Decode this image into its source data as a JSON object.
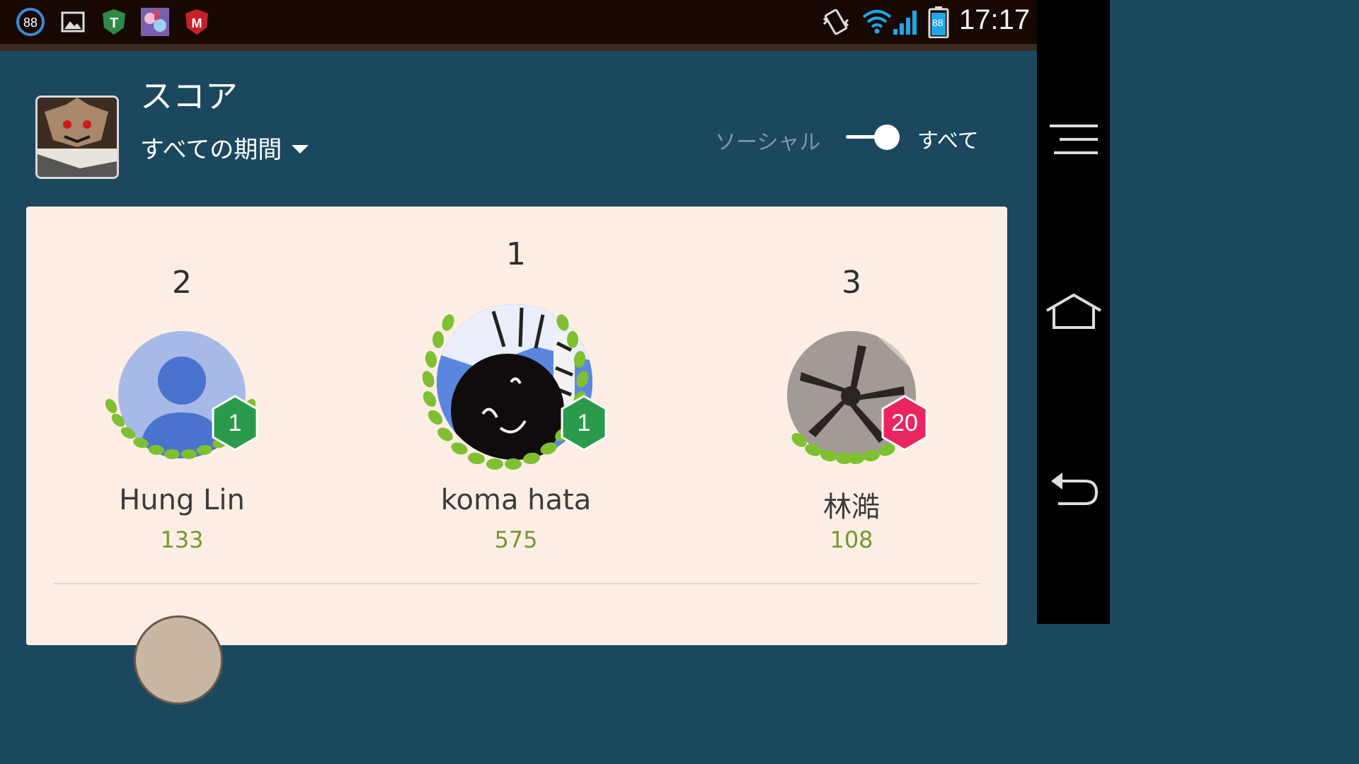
{
  "status_bar": {
    "notification_icons": [
      "battery-88-icon",
      "gallery-icon",
      "trend-micro-icon",
      "game-app-icon",
      "mcafee-icon"
    ],
    "system_icons": [
      "vibrate-icon",
      "wifi-icon",
      "cell-signal-icon",
      "battery-icon"
    ],
    "battery_badge": "88",
    "clock": "17:17"
  },
  "header": {
    "title": "スコア",
    "period_label": "すべての期間",
    "filter": {
      "left_label": "ソーシャル",
      "right_label": "すべて",
      "selected": "すべて"
    }
  },
  "leaderboard": {
    "players": [
      {
        "rank": "2",
        "name": "Hung Lin",
        "score": "133",
        "level": "1",
        "level_color": "#2a9b4a"
      },
      {
        "rank": "1",
        "name": "koma hata",
        "score": "575",
        "level": "1",
        "level_color": "#2a9b4a"
      },
      {
        "rank": "3",
        "name": "林澔",
        "score": "108",
        "level": "20",
        "level_color": "#e9265f"
      }
    ]
  },
  "nav_bar": {
    "buttons": [
      "menu-icon",
      "home-icon",
      "back-icon"
    ]
  }
}
